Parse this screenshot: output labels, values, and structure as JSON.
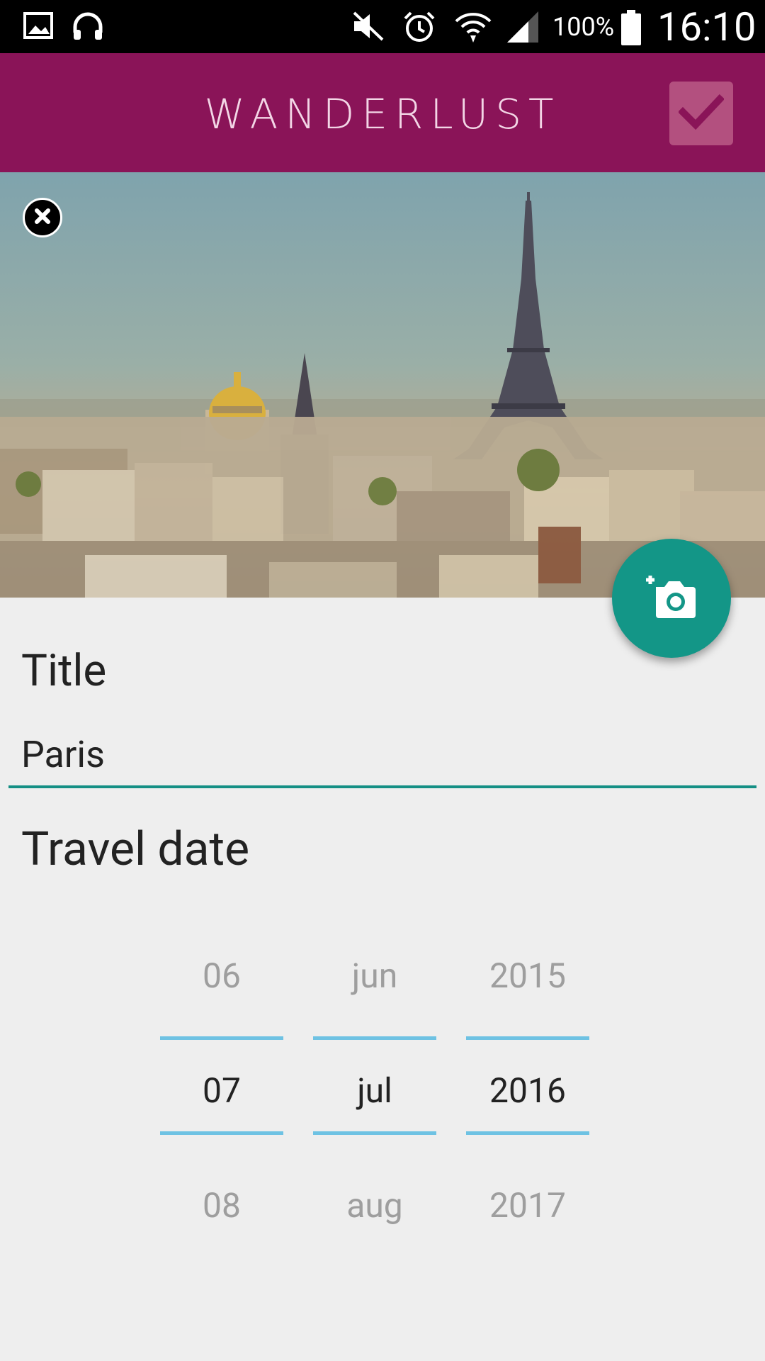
{
  "status_bar": {
    "battery_percent": "100%",
    "time": "16:10",
    "icons": [
      "gallery-icon",
      "headphones-icon",
      "mute-icon",
      "alarm-icon",
      "wifi-icon",
      "signal-icon",
      "battery-icon"
    ]
  },
  "app_bar": {
    "logo_text": "WANDERLUST",
    "confirm_icon": "check-icon",
    "color": "#8a1458"
  },
  "hero": {
    "remove_icon": "close-icon",
    "camera_icon": "add-photo-icon",
    "accent": "#139687"
  },
  "form": {
    "title_label": "Title",
    "title_value": "Paris",
    "date_label": "Travel date"
  },
  "date_picker": {
    "day": {
      "prev": "06",
      "current": "07",
      "next": "08"
    },
    "month": {
      "prev": "jun",
      "current": "jul",
      "next": "aug"
    },
    "year": {
      "prev": "2015",
      "current": "2016",
      "next": "2017"
    }
  }
}
